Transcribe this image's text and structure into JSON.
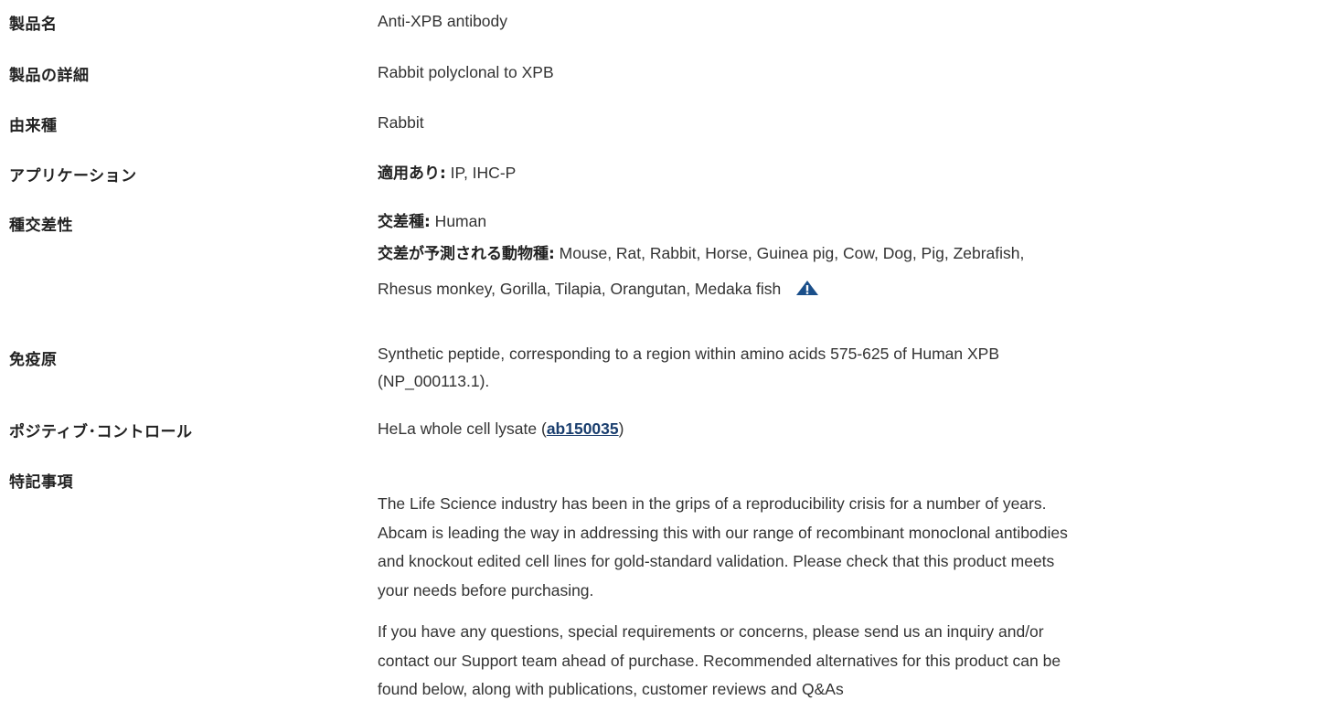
{
  "rows": {
    "product_name": {
      "label": "製品名",
      "value": "Anti-XPB antibody"
    },
    "description": {
      "label": "製品の詳細",
      "value": "Rabbit polyclonal to XPB"
    },
    "host": {
      "label": "由来種",
      "value": "Rabbit"
    },
    "applications": {
      "label": "アプリケーション",
      "key": "適用あり:",
      "value": " IP, IHC-P"
    },
    "reactivity": {
      "label": "種交差性",
      "reacts_key": "交差種:",
      "reacts_value": " Human",
      "predicted_key": "交差が予測される動物種:",
      "predicted_line1": " Mouse, Rat, Rabbit, Horse, Guinea pig, Cow, Dog, Pig, Zebrafish,",
      "predicted_line2": "Rhesus monkey, Gorilla, Tilapia, Orangutan, Medaka fish",
      "warning_icon": "warning-triangle-icon",
      "warning_color": "#1a4f8a"
    },
    "immunogen": {
      "label": "免疫原",
      "line1": "Synthetic peptide, corresponding to a region within amino acids 575-625 of Human XPB",
      "line2": "(NP_000113.1)."
    },
    "positive_control": {
      "label": "ポジティブ･コントロール",
      "prefix": "HeLa whole cell lysate (",
      "link": "ab150035",
      "suffix": ")"
    },
    "notes": {
      "label": "特記事項",
      "para1_line1": "The Life Science industry has been in the grips of a reproducibility crisis for a number of years.",
      "para1_line2": "Abcam is leading the way in addressing this with our range of recombinant monoclonal antibodies",
      "para1_line3": "and knockout edited cell lines for gold-standard validation. Please check that this product meets",
      "para1_line4": "your needs before purchasing.",
      "para2_line1": "If you have any questions, special requirements or concerns, please send us an inquiry and/or",
      "para2_line2": "contact our Support team ahead of purchase. Recommended alternatives for this product can be",
      "para2_line3": "found below, along with publications, customer reviews and Q&As"
    }
  },
  "colors": {
    "text": "#333333",
    "label": "#222222",
    "link": "#1a3e6e"
  }
}
